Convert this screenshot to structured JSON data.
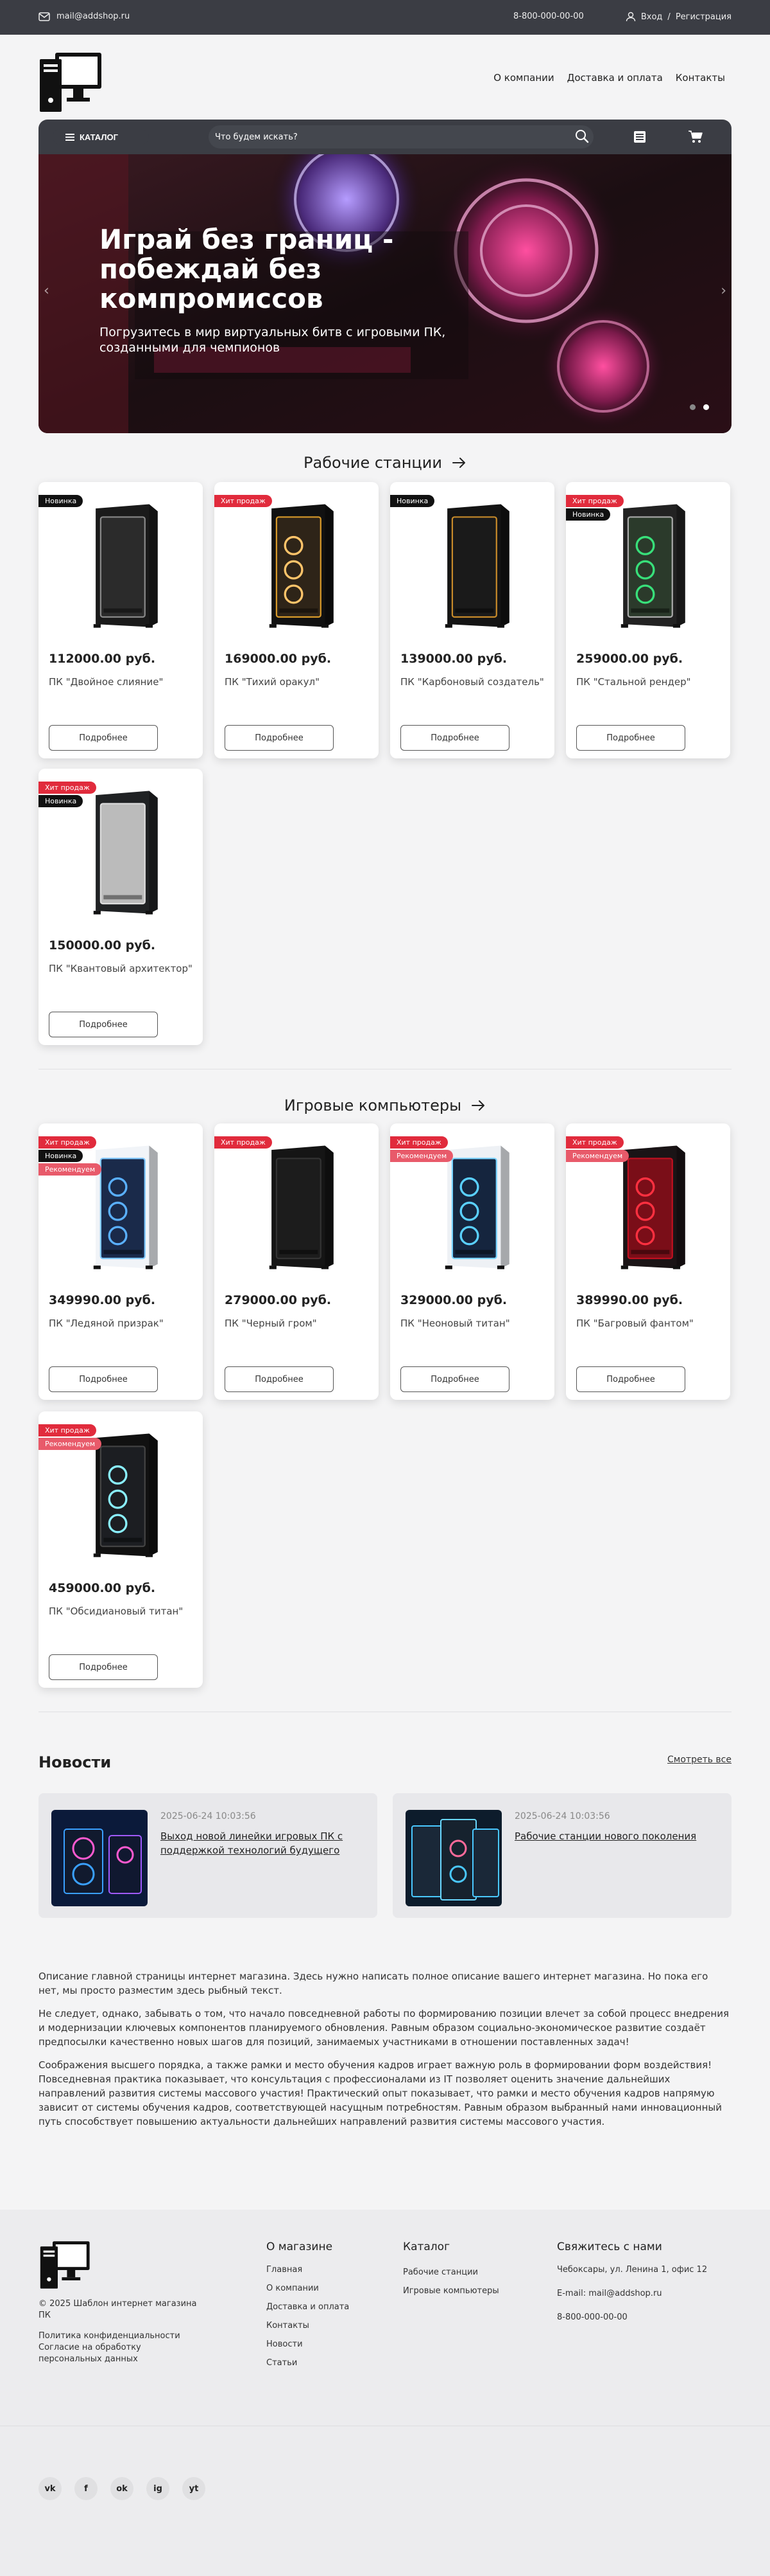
{
  "topbar": {
    "email": "mail@addshop.ru",
    "phone": "8-800-000-00-00",
    "login": "Вход",
    "separator": "/",
    "register": "Регистрация"
  },
  "nav": {
    "about": "О компании",
    "delivery": "Доставка и оплата",
    "contacts": "Контакты"
  },
  "search": {
    "catalog_label": "КАТАЛОГ",
    "placeholder": "Что будем искать?"
  },
  "hero": {
    "title": "Играй без границ - побеждай без компромиссов",
    "subtitle": "Погрузитесь в мир виртуальных битв с игровыми ПК, созданными для чемпионов"
  },
  "sections": {
    "workstations": {
      "title": "Рабочие станции",
      "products": [
        {
          "price": "112000.00 руб.",
          "name": "ПК \"Двойное слияние\"",
          "badges": [
            "Новинка"
          ],
          "more": "Подробнее"
        },
        {
          "price": "169000.00 руб.",
          "name": "ПК \"Тихий оракул\"",
          "badges": [
            "Хит продаж"
          ],
          "more": "Подробнее"
        },
        {
          "price": "139000.00 руб.",
          "name": "ПК \"Карбоновый создатель\"",
          "badges": [
            "Новинка"
          ],
          "more": "Подробнее"
        },
        {
          "price": "259000.00 руб.",
          "name": "ПК \"Стальной рендер\"",
          "badges": [
            "Хит продаж",
            "Новинка"
          ],
          "more": "Подробнее"
        },
        {
          "price": "150000.00 руб.",
          "name": "ПК \"Квантовый архитектор\"",
          "badges": [
            "Хит продаж",
            "Новинка"
          ],
          "more": "Подробнее"
        }
      ]
    },
    "gaming": {
      "title": "Игровые компьютеры",
      "products": [
        {
          "price": "349990.00 руб.",
          "name": "ПК \"Ледяной призрак\"",
          "badges": [
            "Хит продаж",
            "Новинка",
            "Рекомендуем"
          ],
          "more": "Подробнее"
        },
        {
          "price": "279000.00 руб.",
          "name": "ПК \"Черный гром\"",
          "badges": [
            "Хит продаж"
          ],
          "more": "Подробнее"
        },
        {
          "price": "329000.00 руб.",
          "name": "ПК \"Неоновый титан\"",
          "badges": [
            "Хит продаж",
            "Рекомендуем"
          ],
          "more": "Подробнее"
        },
        {
          "price": "389990.00 руб.",
          "name": "ПК \"Багровый фантом\"",
          "badges": [
            "Хит продаж",
            "Рекомендуем"
          ],
          "more": "Подробнее"
        },
        {
          "price": "459000.00 руб.",
          "name": "ПК \"Обсидиановый титан\"",
          "badges": [
            "Хит продаж",
            "Рекомендуем"
          ],
          "more": "Подробнее"
        }
      ]
    }
  },
  "news": {
    "title": "Новости",
    "all_label": "Смотреть все",
    "items": [
      {
        "date": "2025-06-24 10:03:56",
        "title": "Выход новой линейки игровых ПК с поддержкой технологий будущего"
      },
      {
        "date": "2025-06-24 10:03:56",
        "title": "Рабочие станции нового поколения"
      }
    ]
  },
  "about": {
    "p1": "Описание главной страницы интернет магазина. Здесь нужно написать полное описание вашего интернет магазина. Но пока его нет, мы просто разместим здесь рыбный текст.",
    "p2": "Не следует, однако, забывать о том, что начало повседневной работы по формированию позиции влечет за собой процесс внедрения и модернизации ключевых компонентов планируемого обновления. Равным образом социально-экономическое развитие создаёт предпосылки качественно новых шагов для позиций, занимаемых участниками в отношении поставленных задач!",
    "p3": "Соображения высшего порядка, а также рамки и место обучения кадров играет важную роль в формировании форм воздействия! Повседневная практика показывает, что консультация с профессионалами из IT позволяет оценить значение дальнейших направлений развития системы массового участия! Практический опыт показывает, что рамки и место обучения кадров напрямую зависит от системы обучения кадров, соответствующей насущным потребностям. Равным образом выбранный нами инновационный путь способствует повышению актуальности дальнейших направлений развития системы массового участия."
  },
  "footer": {
    "copyright": "© 2025 Шаблон интернет магазина ПК",
    "privacy": "Политика конфиденциальности",
    "consent": "Согласие на обработку персональных данных",
    "about_title": "О магазине",
    "about_links": [
      "Главная",
      "О компании",
      "Доставка и оплата",
      "Контакты",
      "Новости",
      "Статьи"
    ],
    "catalog_title": "Каталог",
    "catalog_links": [
      "Рабочие станции",
      "Игровые компьютеры"
    ],
    "contact_title": "Свяжитесь с нами",
    "address": "Чебоксары, ул. Ленина 1, офис 12",
    "email": "E-mail: mail@addshop.ru",
    "phone": "8-800-000-00-00",
    "social": [
      "vk",
      "f",
      "ok",
      "ig",
      "yt"
    ]
  },
  "colors": {
    "dark": "#3b3d44",
    "accent_red": "#e12b3c",
    "badge_black": "#111111"
  }
}
